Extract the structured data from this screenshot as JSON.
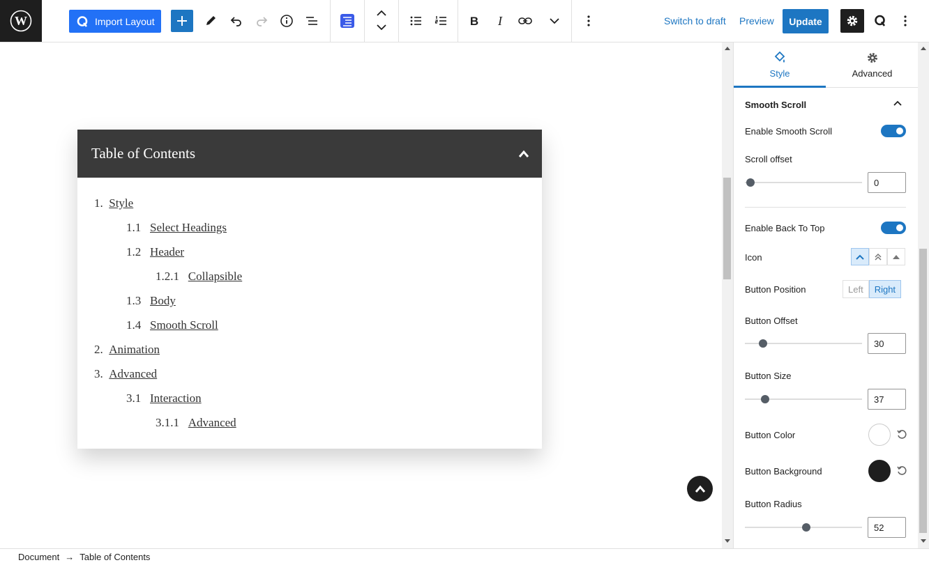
{
  "topbar": {
    "import_label": "Import Layout",
    "switch_draft": "Switch to draft",
    "preview": "Preview",
    "update": "Update"
  },
  "toc": {
    "title": "Table of Contents",
    "items": [
      {
        "num": "1.",
        "label": "Style"
      },
      {
        "num": "1.1",
        "label": "Select Headings"
      },
      {
        "num": "1.2",
        "label": "Header"
      },
      {
        "num": "1.2.1",
        "label": "Collapsible"
      },
      {
        "num": "1.3",
        "label": "Body"
      },
      {
        "num": "1.4",
        "label": "Smooth Scroll"
      },
      {
        "num": "2.",
        "label": "Animation"
      },
      {
        "num": "3.",
        "label": "Advanced"
      },
      {
        "num": "3.1",
        "label": "Interaction"
      },
      {
        "num": "3.1.1",
        "label": "Advanced"
      }
    ]
  },
  "statusbar": {
    "crumb_root": "Document",
    "arrow": "→",
    "crumb_current": "Table of Contents"
  },
  "sidebar": {
    "tabs": {
      "style": "Style",
      "advanced": "Advanced"
    },
    "panel_title": "Smooth Scroll",
    "enable_smooth": "Enable Smooth Scroll",
    "enable_smooth_on": true,
    "scroll_offset_label": "Scroll offset",
    "scroll_offset_value": "0",
    "enable_back_top": "Enable Back To Top",
    "enable_back_top_on": true,
    "icon_label": "Icon",
    "button_position_label": "Button Position",
    "position_left": "Left",
    "position_right": "Right",
    "button_offset_label": "Button Offset",
    "button_offset_value": "30",
    "button_size_label": "Button Size",
    "button_size_value": "37",
    "button_color_label": "Button Color",
    "button_color": "#ffffff",
    "button_background_label": "Button Background",
    "button_background": "#1e1e1e",
    "button_radius_label": "Button Radius",
    "button_radius_value": "52"
  },
  "colors": {
    "accent": "#1d76c2",
    "import_blue": "#2271f6",
    "dark": "#1e1e1e",
    "toc_header": "#3a3a3a"
  }
}
